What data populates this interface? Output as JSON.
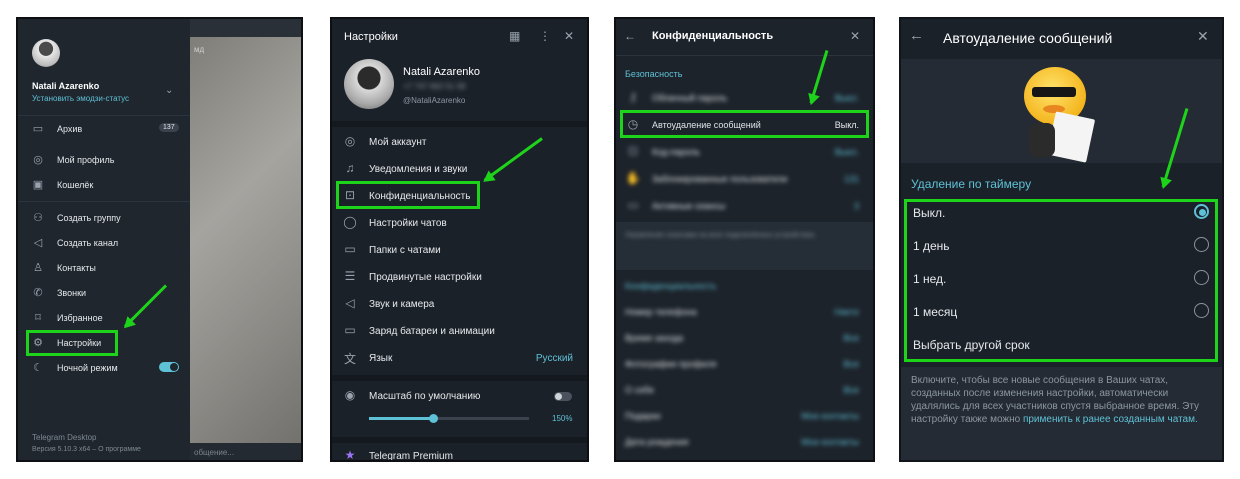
{
  "panel1": {
    "user_name": "Natali Azarenko",
    "emoji_status": "Установить эмодзи-статус",
    "menu": [
      {
        "icon": "archive-icon",
        "label": "Архив",
        "badge": "137"
      },
      {
        "icon": "profile-icon",
        "label": "Мой профиль"
      },
      {
        "icon": "wallet-icon",
        "label": "Кошелёк"
      },
      {
        "icon": "group-icon",
        "label": "Создать группу"
      },
      {
        "icon": "megaphone-icon",
        "label": "Создать канал"
      },
      {
        "icon": "contacts-icon",
        "label": "Контакты"
      },
      {
        "icon": "phone-icon",
        "label": "Звонки"
      },
      {
        "icon": "bookmark-icon",
        "label": "Избранное"
      },
      {
        "icon": "gear-icon",
        "label": "Настройки"
      },
      {
        "icon": "moon-icon",
        "label": "Ночной режим"
      }
    ],
    "footer_title": "Telegram Desktop",
    "footer_version": "Версия 5.10.3 x64 – О программе",
    "bg_tab_text": "мд",
    "bg_bottom_text": "общение..."
  },
  "panel2": {
    "title": "Настройки",
    "user_name": "Natali Azarenko",
    "phone": "+7 747 662 51 58",
    "username": "@NataliAzarenko",
    "items": [
      {
        "icon": "account-icon",
        "label": "Мой аккаунт"
      },
      {
        "icon": "bell-icon",
        "label": "Уведомления и звуки"
      },
      {
        "icon": "lock-icon",
        "label": "Конфиденциальность"
      },
      {
        "icon": "chat-icon",
        "label": "Настройки чатов"
      },
      {
        "icon": "folder-icon",
        "label": "Папки с чатами"
      },
      {
        "icon": "sliders-icon",
        "label": "Продвинутые настройки"
      },
      {
        "icon": "speaker-icon",
        "label": "Звук и камера"
      },
      {
        "icon": "battery-icon",
        "label": "Заряд батареи и анимации"
      },
      {
        "icon": "translate-icon",
        "label": "Язык",
        "value": "Русский"
      }
    ],
    "scale_label": "Масштаб по умолчанию",
    "scale_value": "150%",
    "scale_fraction": 0.4,
    "premium_label": "Telegram Premium"
  },
  "panel3": {
    "title": "Конфиденциальность",
    "section_security": "Безопасность",
    "security_items": [
      {
        "label": "Облачный пароль",
        "value": "Выкл."
      },
      {
        "label": "Автоудаление сообщений",
        "value": "Выкл."
      },
      {
        "label": "Код-пароль",
        "value": "Выкл."
      },
      {
        "label": "Заблокированные пользователи",
        "value": "131"
      },
      {
        "label": "Активные сеансы",
        "value": "3"
      }
    ],
    "security_note": "Управление сеансами на всех подключённых устройствах.",
    "section_privacy": "Конфиденциальность",
    "privacy_items": [
      {
        "label": "Номер телефона",
        "value": "Никто"
      },
      {
        "label": "Время захода",
        "value": "Все"
      },
      {
        "label": "Фотографии профиля",
        "value": "Все"
      },
      {
        "label": "О себе",
        "value": "Все"
      },
      {
        "label": "Подарки",
        "value": "Мои контакты"
      },
      {
        "label": "Дата рождения",
        "value": "Мои контакты"
      }
    ]
  },
  "panel4": {
    "title": "Автоудаление сообщений",
    "section": "Удаление по таймеру",
    "options": [
      {
        "label": "Выкл.",
        "selected": true
      },
      {
        "label": "1 день",
        "selected": false
      },
      {
        "label": "1 нед.",
        "selected": false
      },
      {
        "label": "1 месяц",
        "selected": false
      },
      {
        "label": "Выбрать другой срок"
      }
    ],
    "description": "Включите, чтобы все новые сообщения в Ваших чатах, созданных после изменения настройки, автоматически удалялись для всех участников спустя выбранное время. Эту настройку также можно",
    "link": "применить к ранее созданным чатам."
  },
  "colors": {
    "accent": "#5fc1d6",
    "highlight": "#1ed41a",
    "background": "#1b2129"
  }
}
